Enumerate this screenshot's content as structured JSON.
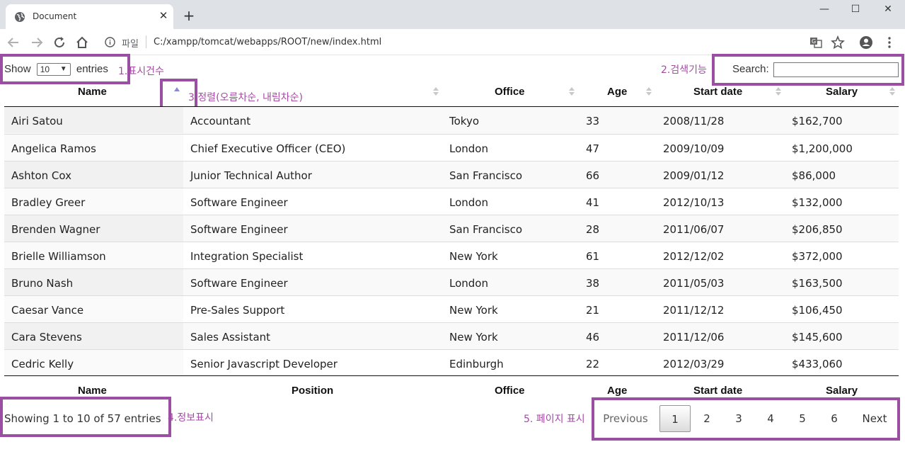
{
  "browser": {
    "tab_title": "Document",
    "tab_close": "✕",
    "new_tab": "+",
    "omnibox_scheme": "파일",
    "url": "C:/xampp/tomcat/webapps/ROOT/new/index.html",
    "window_controls": {
      "minimize": "—",
      "maximize": "☐",
      "close": "✕"
    }
  },
  "controls": {
    "show_label": "Show",
    "length_value": "10",
    "entries_label": "entries",
    "search_label": "Search:",
    "search_value": ""
  },
  "annotations": {
    "a1": "1.표시건수",
    "a2": "2.검색기능",
    "a3": "3.정렬(오름차순, 내림차순)",
    "a4": "4.정보표시",
    "a5": "5. 페이지 표시"
  },
  "table": {
    "headers": [
      "Name",
      "",
      "Office",
      "Age",
      "Start date",
      "Salary"
    ],
    "footers": [
      "Name",
      "Position",
      "Office",
      "Age",
      "Start date",
      "Salary"
    ],
    "rows": [
      [
        "Airi Satou",
        "Accountant",
        "Tokyo",
        "33",
        "2008/11/28",
        "$162,700"
      ],
      [
        "Angelica Ramos",
        "Chief Executive Officer (CEO)",
        "London",
        "47",
        "2009/10/09",
        "$1,200,000"
      ],
      [
        "Ashton Cox",
        "Junior Technical Author",
        "San Francisco",
        "66",
        "2009/01/12",
        "$86,000"
      ],
      [
        "Bradley Greer",
        "Software Engineer",
        "London",
        "41",
        "2012/10/13",
        "$132,000"
      ],
      [
        "Brenden Wagner",
        "Software Engineer",
        "San Francisco",
        "28",
        "2011/06/07",
        "$206,850"
      ],
      [
        "Brielle Williamson",
        "Integration Specialist",
        "New York",
        "61",
        "2012/12/02",
        "$372,000"
      ],
      [
        "Bruno Nash",
        "Software Engineer",
        "London",
        "38",
        "2011/05/03",
        "$163,500"
      ],
      [
        "Caesar Vance",
        "Pre-Sales Support",
        "New York",
        "21",
        "2011/12/12",
        "$106,450"
      ],
      [
        "Cara Stevens",
        "Sales Assistant",
        "New York",
        "46",
        "2011/12/06",
        "$145,600"
      ],
      [
        "Cedric Kelly",
        "Senior Javascript Developer",
        "Edinburgh",
        "22",
        "2012/03/29",
        "$433,060"
      ]
    ]
  },
  "info": "Showing 1 to 10 of 57 entries",
  "pagination": {
    "previous": "Previous",
    "pages": [
      "1",
      "2",
      "3",
      "4",
      "5",
      "6"
    ],
    "current": "1",
    "next": "Next"
  },
  "colors": {
    "annotation": "#9b4fa3",
    "sort_active": "#8a8ad6",
    "sort_inactive": "#c8c8c8"
  }
}
